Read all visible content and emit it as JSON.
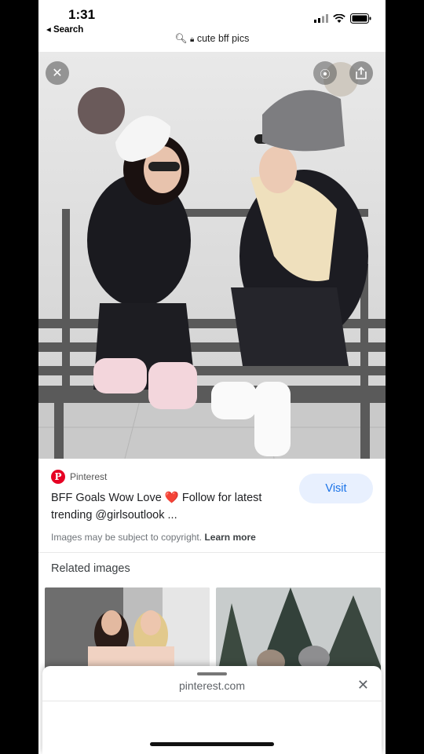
{
  "status_bar": {
    "time": "1:31",
    "back_label": "◂ Search"
  },
  "url_bar": {
    "url": "cute bff pics"
  },
  "hero": {
    "close_icon": "close-icon",
    "lens_icon": "visual-search-icon",
    "share_icon": "share-icon"
  },
  "result": {
    "source_name": "Pinterest",
    "caption_part1": "BFF Goals Wow Love ",
    "caption_heart": "❤️",
    "caption_part2": " Follow for latest trending @girlsoutlook ...",
    "visit_label": "Visit",
    "copyright_text": "Images may be subject to copyright.",
    "learn_more": "Learn more"
  },
  "related": {
    "title": "Related images"
  },
  "sheet": {
    "url": "pinterest.com",
    "close_icon": "close-icon"
  },
  "colors": {
    "accent_blue": "#1a73e8",
    "visit_bg": "#e8f0fe",
    "pinterest_red": "#e60023"
  }
}
